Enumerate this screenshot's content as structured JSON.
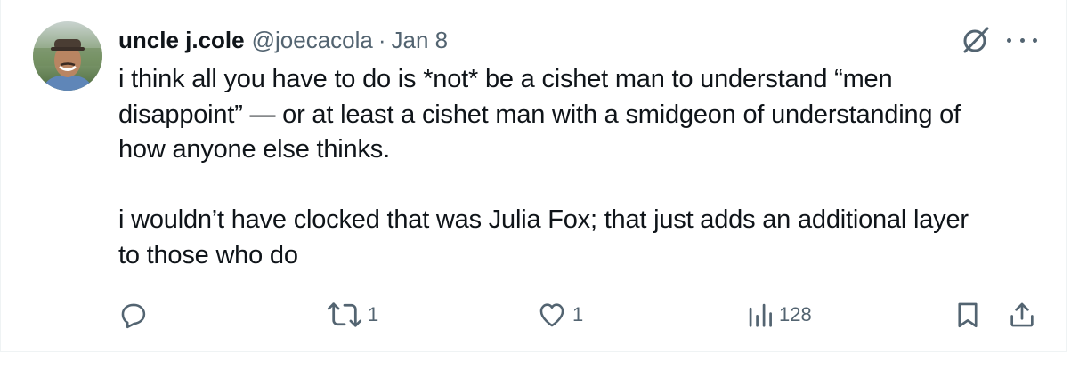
{
  "tweet": {
    "display_name": "uncle j.cole",
    "handle": "@joecacola",
    "separator": "·",
    "date": "Jan 8",
    "text_lines": [
      "i think all you have to do is *not* be a cishet man to understand “men",
      "disappoint” — or at least a cishet man with a smidgeon of understanding of",
      "how anyone else thinks.",
      "i wouldn’t have clocked that was Julia Fox; that just adds an additional layer",
      "to those who do"
    ]
  },
  "actions": {
    "reply": {
      "icon": "reply-icon",
      "count": ""
    },
    "retweet": {
      "icon": "retweet-icon",
      "count": "1"
    },
    "like": {
      "icon": "heart-icon",
      "count": "1"
    },
    "views": {
      "icon": "views-icon",
      "count": "128"
    },
    "bookmark": {
      "icon": "bookmark-icon"
    },
    "share": {
      "icon": "share-icon"
    }
  },
  "colors": {
    "text": "#0f1419",
    "secondary": "#536471",
    "border": "#eff3f4"
  }
}
